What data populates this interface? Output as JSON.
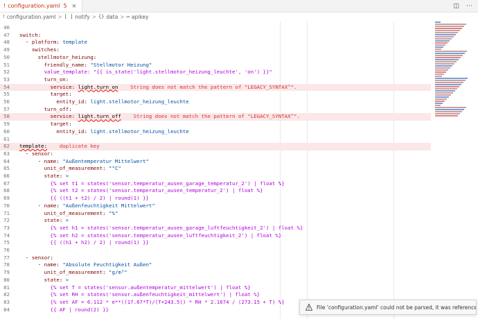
{
  "tab": {
    "label": "configuration.yaml",
    "problem_count": "5",
    "close": "×"
  },
  "breadcrumb": {
    "file": "configuration.yaml",
    "sep": ">",
    "notify_glyph": "[ ]",
    "notify": "notify",
    "data_glyph": "{}",
    "data": "data",
    "apikey_glyph": "▭",
    "apikey": "apikey"
  },
  "editor": {
    "lines": [
      {
        "n": "46",
        "t": ""
      },
      {
        "n": "47",
        "t": "switch:"
      },
      {
        "n": "48",
        "t": "  - platform: template"
      },
      {
        "n": "49",
        "t": "    switches:"
      },
      {
        "n": "50",
        "t": "      stellmotor_heizung:"
      },
      {
        "n": "51",
        "t": "        friendly_name: \"Stellmotor Heizung\""
      },
      {
        "n": "52",
        "t": "        value_template: \"{{ is_state('light.stellmotor_heizung_leuchte', 'on') }}\""
      },
      {
        "n": "53",
        "t": "        turn_on:"
      },
      {
        "n": "54",
        "t": "          service: light.turn_on",
        "m": "String does not match the pattern of \"LEGACY_SYNTAX^\".",
        "e": true
      },
      {
        "n": "55",
        "t": "          target:"
      },
      {
        "n": "56",
        "t": "            entity_id: light.stellmotor_heizung_leuchte"
      },
      {
        "n": "57",
        "t": "        turn_off:"
      },
      {
        "n": "58",
        "t": "          service: light.turn_off",
        "m": "String does not match the pattern of \"LEGACY_SYNTAX^\".",
        "e": true
      },
      {
        "n": "59",
        "t": "          target:"
      },
      {
        "n": "60",
        "t": "            entity_id: light.stellmotor_heizung_leuchte"
      },
      {
        "n": "61",
        "t": ""
      },
      {
        "n": "62",
        "t": "template:",
        "m": "duplicate key",
        "e": true
      },
      {
        "n": "63",
        "t": "  - sensor:"
      },
      {
        "n": "64",
        "t": "      - name: \"Außentemperatur Mittelwert\""
      },
      {
        "n": "65",
        "t": "        unit_of_measurement: \"°C\""
      },
      {
        "n": "66",
        "t": "        state: >"
      },
      {
        "n": "67",
        "t": "          {% set t1 = states('sensor.temperatur_ausen_garage_temperatur_2') | float %}"
      },
      {
        "n": "68",
        "t": "          {% set t2 = states('sensor.temperatur_ausen_temperatur_2') | float %}"
      },
      {
        "n": "69",
        "t": "          {{ ((t1 + t2) / 2) | round(1) }}"
      },
      {
        "n": "70",
        "t": "      - name: \"Außenfeuchtigkeit Mittelwert\""
      },
      {
        "n": "71",
        "t": "        unit_of_measurement: \"%\""
      },
      {
        "n": "72",
        "t": "        state: >"
      },
      {
        "n": "73",
        "t": "          {% set h1 = states('sensor.temperatur_ausen_garage_luftfeuchtigkeit_2') | float %}"
      },
      {
        "n": "74",
        "t": "          {% set h2 = states('sensor.temperatur_ausen_luftfeuchtigkeit_2') | float %}"
      },
      {
        "n": "75",
        "t": "          {{ ((h1 + h2) / 2) | round(1) }}"
      },
      {
        "n": "76",
        "t": ""
      },
      {
        "n": "77",
        "t": "  - sensor:"
      },
      {
        "n": "78",
        "t": "      - name: \"Absolute Feuchtigkeit Außen\""
      },
      {
        "n": "79",
        "t": "        unit_of_measurement: \"g/m³\""
      },
      {
        "n": "80",
        "t": "        state: >"
      },
      {
        "n": "81",
        "t": "          {% set T = states('sensor.außentemperatur_mittelwert') | float %}"
      },
      {
        "n": "82",
        "t": "          {% set RH = states('sensor.außenfeuchtigkeit_mittelwert') | float %}"
      },
      {
        "n": "83",
        "t": "          {% set AF = 6.112 * e**((17.67*T)/(T+243.5)) * RH * 2.1674 / (273.15 + T) %}"
      },
      {
        "n": "84",
        "t": "          {{ AF | round(2) }}"
      }
    ]
  },
  "notification": {
    "text": "File 'configuration.yaml' could not be parsed, it was referenced from p..."
  },
  "colors": {
    "error": "#e51400",
    "key": "#800000",
    "string": "#0451a5"
  }
}
